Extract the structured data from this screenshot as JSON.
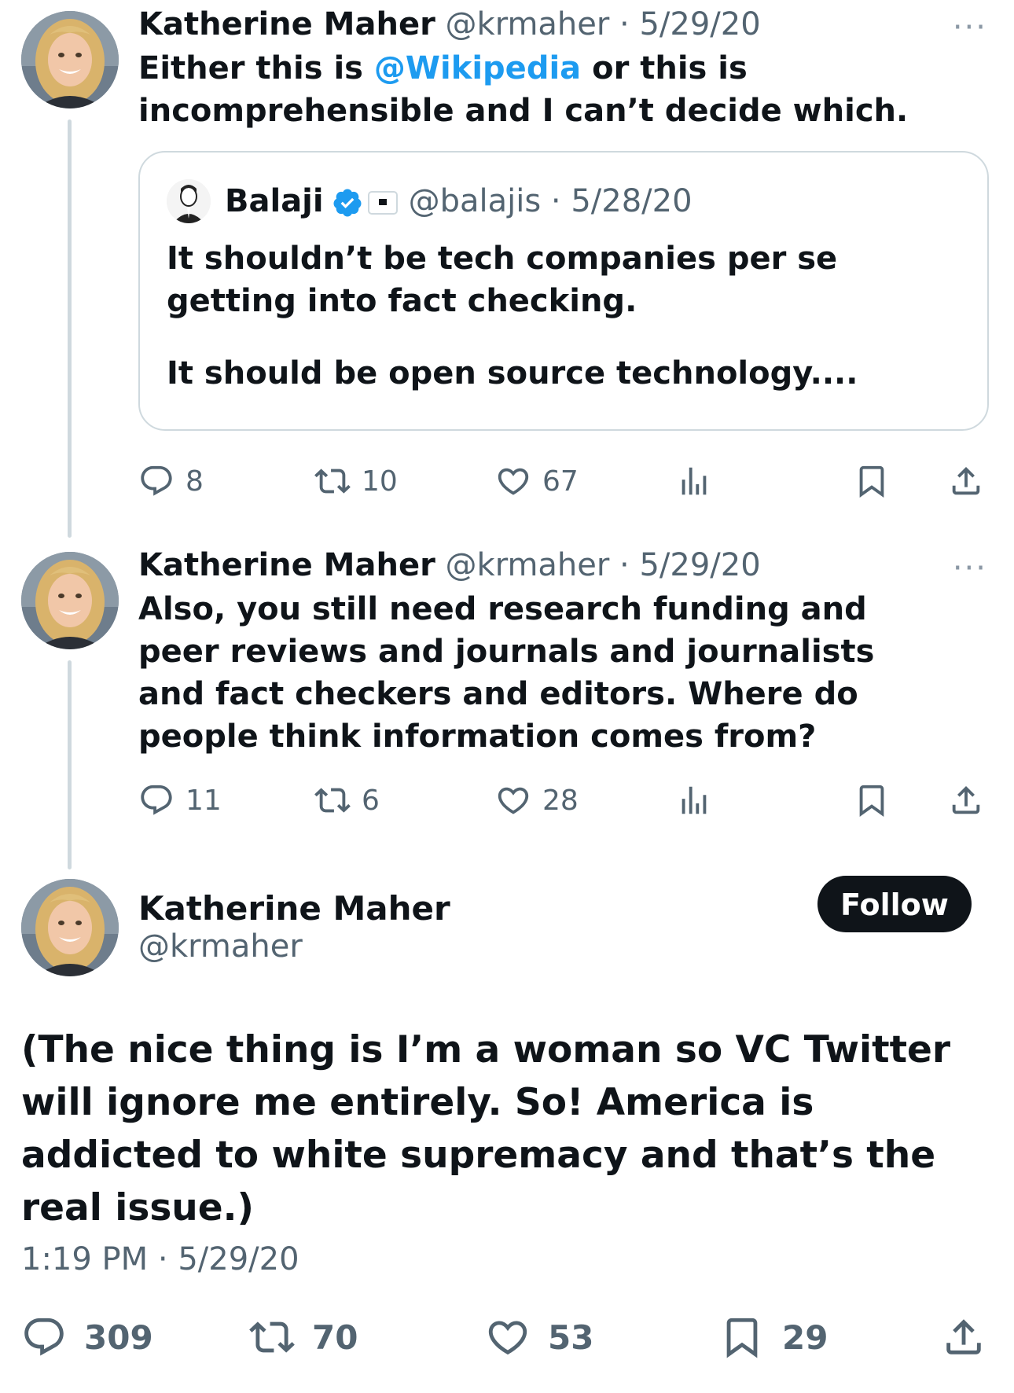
{
  "tweet1": {
    "name": "Katherine Maher",
    "handle": "@krmaher",
    "date": "5/29/20",
    "text_pre": "Either this is ",
    "mention": "@Wikipedia",
    "text_post": " or this is incomprehensible and I can’t decide which.",
    "quote": {
      "name": "Balaji",
      "handle": "@balajis",
      "date": "5/28/20",
      "para1": "It shouldn’t be tech companies per se getting into fact checking.",
      "para2": "It should be open source technology...."
    },
    "replies": "8",
    "retweets": "10",
    "likes": "67"
  },
  "tweet2": {
    "name": "Katherine Maher",
    "handle": "@krmaher",
    "date": "5/29/20",
    "text": "Also, you still need research funding and peer reviews and journals and journalists and fact checkers and editors. Where do people think information comes from?",
    "replies": "11",
    "retweets": "6",
    "likes": "28"
  },
  "main_tweet": {
    "name": "Katherine Maher",
    "handle": "@krmaher",
    "follow_label": "Follow",
    "text": "(The nice thing is I’m a woman so VC Twitter will ignore me entirely. So! America is addicted to white supremacy and that’s the real issue.)",
    "timestamp": "1:19 PM · 5/29/20",
    "replies": "309",
    "retweets": "70",
    "likes": "53",
    "bookmarks": "29"
  },
  "separator": " · ",
  "more_label": "···",
  "colors": {
    "text": "#0f1419",
    "secondary": "#536471",
    "link": "#1d9bf0",
    "border": "#cfd9de",
    "button": "#0f1419"
  }
}
